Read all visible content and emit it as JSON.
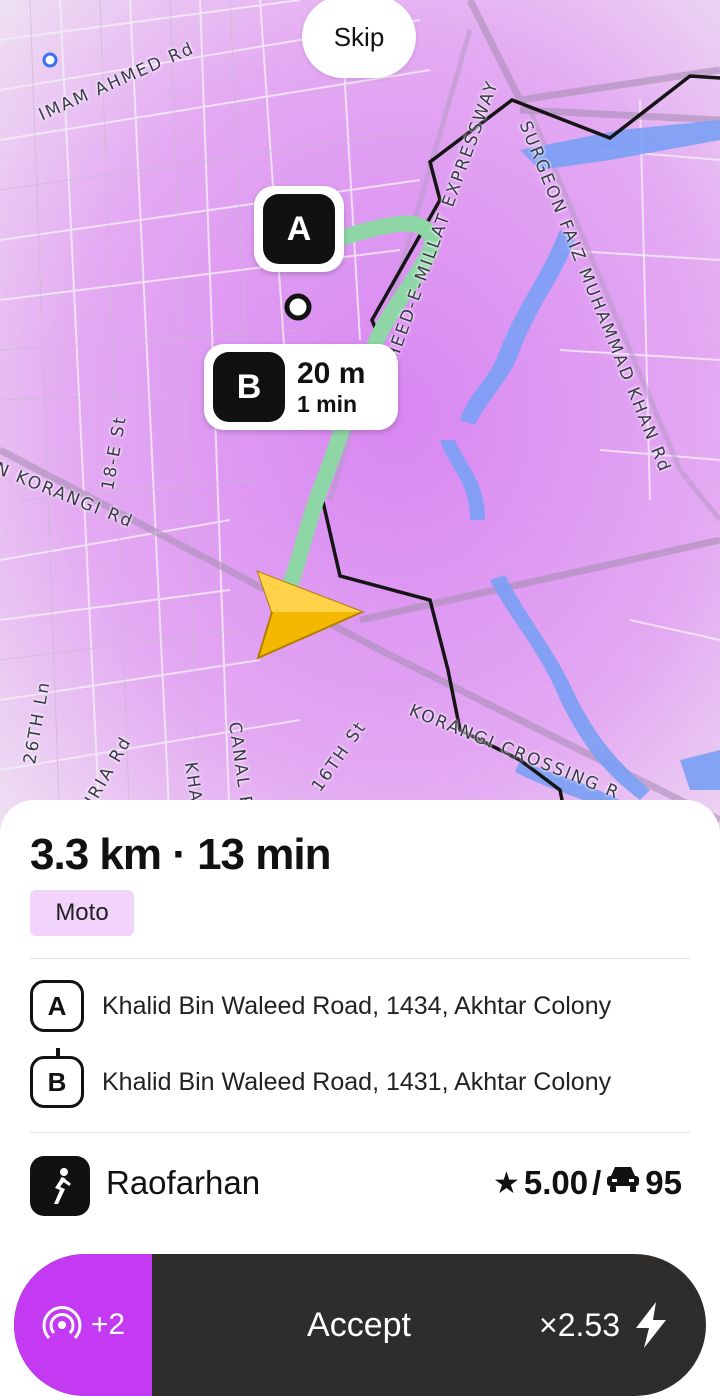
{
  "header": {
    "skip_label": "Skip"
  },
  "map": {
    "road_labels": {
      "imam": "IMAM AHMED Rd",
      "expressway": "HEED-E-MILLAT EXPRESSWAY",
      "surgeon": "SURGEON FAIZ MUHAMMAD KHAN Rd",
      "korangi": "N KORANGI Rd",
      "e18": "18-E St",
      "lane26": "26TH Ln",
      "hria": "HRIA Rd",
      "kha": "KHA",
      "canal": "CANAL R",
      "st16": "16TH St",
      "crossing": "KORANGI CROSSING R"
    },
    "pickup_pin": "A",
    "dropoff_pin": {
      "letter": "B",
      "distance": "20 m",
      "time": "1 min"
    },
    "colors": {
      "zone": "#d98af0",
      "route": "#9fe0b3",
      "arrow": "#f5b800"
    }
  },
  "trip": {
    "summary": "3.3 km · 13 min",
    "vehicle_tag": "Moto",
    "stops": [
      {
        "letter": "A",
        "address": "Khalid Bin Waleed Road, 1434, Akhtar Colony"
      },
      {
        "letter": "B",
        "address": "Khalid Bin Waleed Road, 1431, Akhtar Colony"
      }
    ]
  },
  "customer": {
    "name": "Raofarhan",
    "rating": "5.00",
    "separator": "/",
    "rides": "95",
    "icon": "person-icon"
  },
  "actions": {
    "boost_label": "+2",
    "accept_label": "Accept",
    "surge_label": "×2.53",
    "colors": {
      "boost": "#c43af2",
      "bar": "#2f2d2c"
    }
  }
}
